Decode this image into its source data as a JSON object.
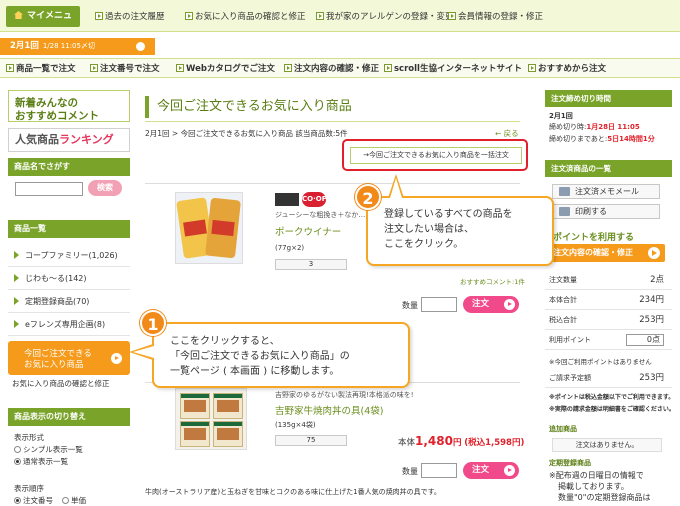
{
  "topbar": {
    "mymenu": "マイメニュー",
    "links": [
      "過去の注文履歴",
      "お気に入り商品の確認と修正",
      "我が家のアレルゲンの登録・変更",
      "会員情報の登録・修正"
    ]
  },
  "datebar": {
    "round": "2月1回",
    "sub": "1/28 11:05〆切"
  },
  "nav": [
    "商品一覧で注文",
    "注文番号で注文",
    "Webカタログでご注文",
    "注文内容の確認・修正",
    "scroll生協インターネットサイト",
    "おすすめから注文"
  ],
  "left": {
    "banner1_line1": "新着みんなの",
    "banner1_line2": "おすすめコメント",
    "banner2_a": "人気商品",
    "banner2_b": "ランキング",
    "search_head": "商品名でさがす",
    "search_btn": "検索",
    "cat_head": "商品一覧",
    "categories": [
      "コープファミリー(1,026)",
      "じわも～る(142)",
      "定期登録商品(70)",
      "eフレンズ専用企画(8)"
    ],
    "fav_btn_line1": "今回ご注文できる",
    "fav_btn_line2": "お気に入り商品",
    "fav_sublink": "お気に入り商品の確認と修正",
    "display_head": "商品表示の切り替え",
    "display_label": "表示形式",
    "display_opt1": "シンプル表示一覧",
    "display_opt2": "通常表示一覧",
    "order_label": "表示順序",
    "order_opt1": "注文番号",
    "order_opt2": "単価"
  },
  "main": {
    "title": "今回ご注文できるお気に入り商品",
    "breadcrumb": "2月1回 > 今回ご注文できるお気に入り商品 該当商品数:5件",
    "back": "← 戻る",
    "bulk_button": "→今回ご注文できるお気に入り商品を一括注文",
    "qty_label": "数量",
    "order_btn": "注文",
    "products": [
      {
        "sub": "ジューシーな粗挽き＋なか…",
        "name": "ポークウイナー",
        "spec": "(77g×2)",
        "qty": "3",
        "unit": "おすすめコメント:1件",
        "coop": "CO·OP"
      },
      {
        "sub": "吉野家のゆるがない製法再現!本格派の味を!",
        "name": "吉野家牛焼肉丼の具(4袋)",
        "spec": "(135g×4袋)",
        "qty": "75",
        "price_label": "本体",
        "price": "1,480",
        "price_unit": "円",
        "tax_price": "(税込1,598円)",
        "desc": "牛肉(オーストラリア産)と玉ねぎを甘味とコクのある味に仕上げた1番人気の焼肉丼の具です。"
      }
    ]
  },
  "right": {
    "deadline_head": "注文締め切り時間",
    "deadline_round": "2月1回",
    "deadline_label": "締め切り時:",
    "deadline_value": "1月28日 11:05",
    "remaining_label": "締め切りまであと:",
    "remaining_value": "5日14時間1分",
    "list_head": "注文済商品の一覧",
    "memo_btn": "注文済メモメール",
    "print_btn": "印刷する",
    "point_link": "ポイントを利用する",
    "confirm_btn": "注文内容の確認・修正",
    "rows": [
      {
        "label": "注文数量",
        "value": "2点"
      },
      {
        "label": "本体合計",
        "value": "234円"
      },
      {
        "label": "税込合計",
        "value": "253円"
      },
      {
        "label": "利用ポイント",
        "value": "0点"
      }
    ],
    "note1": "※今回ご利用ポイントはありません",
    "expected_label": "ご請求予定額",
    "expected_value": "253円",
    "note2": "※ポイントは税込金額以下でご利用できます。",
    "note3": "※実際の請求金額は明細書をご確認ください。",
    "cart_head": "追加商品",
    "cart_empty": "注文はありません。",
    "regular_head": "定期登録商品",
    "regular_note1": "※配布週の日曜日の情報で",
    "regular_note2": "掲載しております。",
    "regular_note3": "数量\"0\"の定期登録商品は"
  },
  "callouts": {
    "c1_num": "1",
    "c1_l1": "ここをクリックすると、",
    "c1_l2": "「今回ご注文できるお気に入り商品」の",
    "c1_l3": "一覧ページ ( 本画面 ) に移動します。",
    "c2_num": "2",
    "c2_l1": "登録しているすべての商品を",
    "c2_l2": "注文したい場合は、",
    "c2_l3": "ここをクリック。"
  },
  "colors": {
    "green": "#7aa32a",
    "orange": "#f59a1b",
    "pink": "#f04a8a",
    "red": "#e0202a"
  }
}
